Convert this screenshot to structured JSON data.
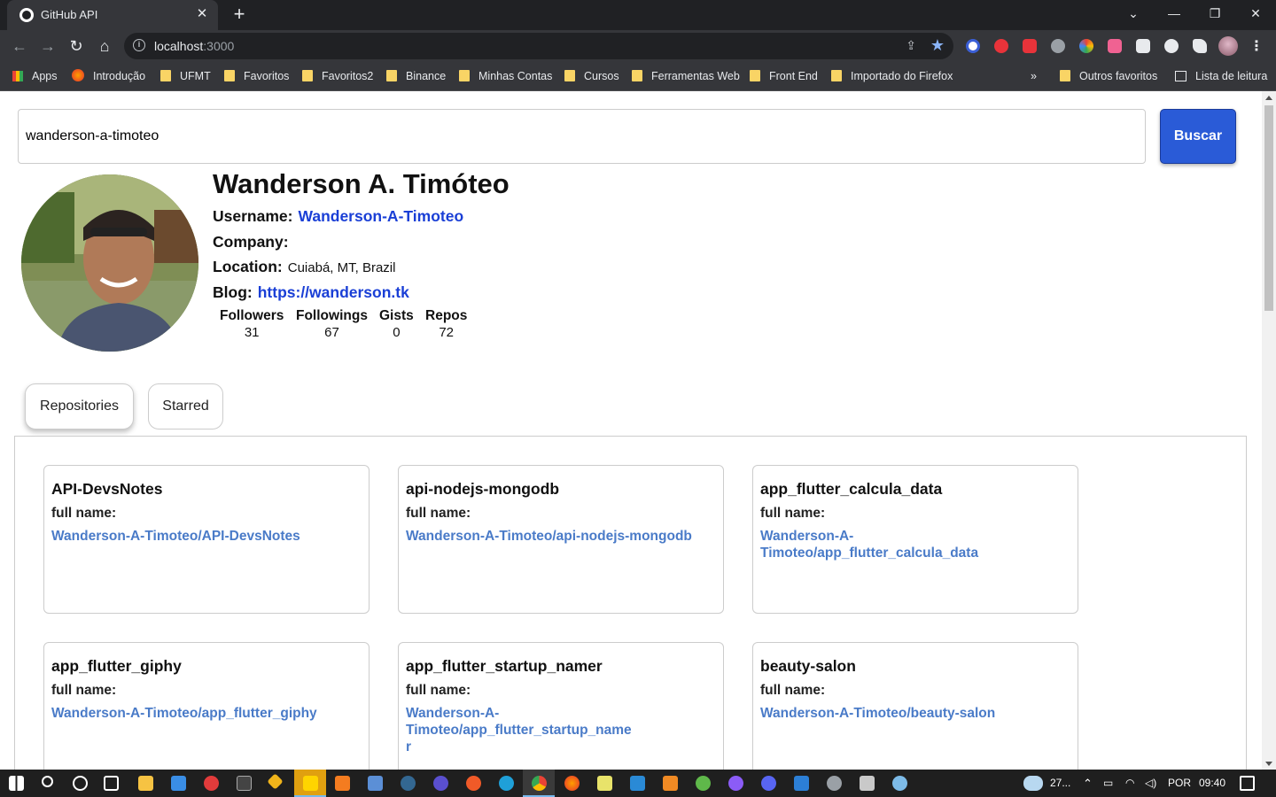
{
  "browser": {
    "tab_title": "GitHub API",
    "url_host": "localhost",
    "url_port": ":3000",
    "bookmarks": [
      "Apps",
      "Introdução",
      "UFMT",
      "Favoritos",
      "Favoritos2",
      "Binance",
      "Minhas Contas",
      "Cursos",
      "Ferramentas Web",
      "Front End",
      "Importado do Firefox"
    ],
    "bookmarks_more": "»",
    "other_bookmarks": "Outros favoritos",
    "reading_list": "Lista de leitura"
  },
  "search": {
    "value": "wanderson-a-timoteo",
    "button_label": "Buscar"
  },
  "profile": {
    "name": "Wanderson A. Timóteo",
    "username_label": "Username:",
    "username": "Wanderson-A-Timoteo",
    "company_label": "Company:",
    "company": "",
    "location_label": "Location:",
    "location": "Cuiabá, MT, Brazil",
    "blog_label": "Blog:",
    "blog": "https://wanderson.tk",
    "stats": [
      {
        "label": "Followers",
        "value": "31"
      },
      {
        "label": "Followings",
        "value": "67"
      },
      {
        "label": "Gists",
        "value": "0"
      },
      {
        "label": "Repos",
        "value": "72"
      }
    ]
  },
  "tabs": [
    {
      "label": "Repositories"
    },
    {
      "label": "Starred"
    }
  ],
  "repos": [
    {
      "name": "API-DevsNotes",
      "full_name_label": "full name:",
      "full_name": "Wanderson-A-Timoteo/API-DevsNotes"
    },
    {
      "name": "api-nodejs-mongodb",
      "full_name_label": "full name:",
      "full_name": "Wanderson-A-Timoteo/api-nodejs-mongodb"
    },
    {
      "name": "app_flutter_calcula_data",
      "full_name_label": "full name:",
      "full_name": "Wanderson-A-Timoteo/app_flutter_calcula_data"
    },
    {
      "name": "app_flutter_giphy",
      "full_name_label": "full name:",
      "full_name": "Wanderson-A-Timoteo/app_flutter_giphy"
    },
    {
      "name": "app_flutter_startup_namer",
      "full_name_label": "full name:",
      "full_name": "Wanderson-A-Timoteo/app_flutter_startup_namer"
    },
    {
      "name": "beauty-salon",
      "full_name_label": "full name:",
      "full_name": "Wanderson-A-Timoteo/beauty-salon"
    }
  ],
  "taskbar": {
    "weather": "27...",
    "language": "POR",
    "time": "09:40"
  }
}
